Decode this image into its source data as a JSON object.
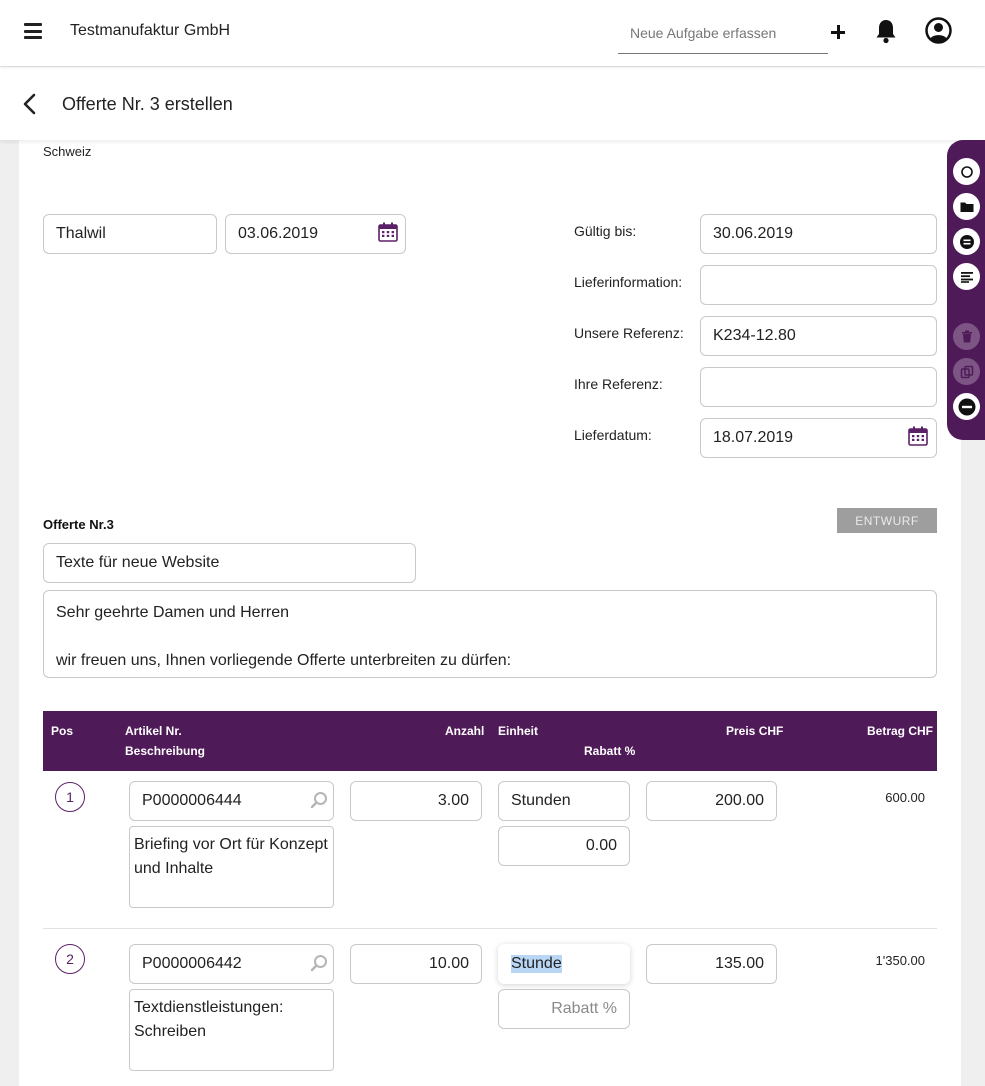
{
  "topbar": {
    "company": "Testmanufaktur GmbH",
    "task_placeholder": "Neue Aufgabe erfassen"
  },
  "subheader": {
    "title": "Offerte Nr. 3 erstellen"
  },
  "address": {
    "country": "Schweiz"
  },
  "place": {
    "city": "Thalwil",
    "date": "03.06.2019"
  },
  "details": {
    "valid_until_label": "Gültig bis:",
    "valid_until": "30.06.2019",
    "delivery_info_label": "Lieferinformation:",
    "delivery_info": "",
    "our_ref_label": "Unsere Referenz:",
    "our_ref": "K234-12.80",
    "your_ref_label": "Ihre Referenz:",
    "your_ref": "",
    "delivery_date_label": "Lieferdatum:",
    "delivery_date": "18.07.2019"
  },
  "offer": {
    "heading": "Offerte Nr.3",
    "status": "ENTWURF",
    "subject": "Texte für neue Website",
    "intro_line1": "Sehr geehrte Damen und Herren",
    "intro_line2": "wir freuen uns, Ihnen vorliegende Offerte unterbreiten zu dürfen:"
  },
  "table": {
    "headers": {
      "pos": "Pos",
      "article": "Artikel Nr.",
      "description": "Beschreibung",
      "quantity": "Anzahl",
      "unit": "Einheit",
      "discount": "Rabatt %",
      "price": "Preis CHF",
      "amount": "Betrag CHF"
    },
    "rows": [
      {
        "pos": "1",
        "article": "P0000006444",
        "description_line1": "Briefing vor Ort für Konzept",
        "description_line2": "und Inhalte",
        "quantity": "3.00",
        "unit": "Stunden",
        "discount": "0.00",
        "discount_placeholder": "",
        "price": "200.00",
        "amount": "600.00"
      },
      {
        "pos": "2",
        "article": "P0000006442",
        "description_line1": "Textdienstleistungen:",
        "description_line2": "Schreiben",
        "quantity": "10.00",
        "unit": "Stunde",
        "discount": "",
        "discount_placeholder": "Rabatt %",
        "price": "135.00",
        "amount": "1'350.00"
      }
    ]
  },
  "colors": {
    "brand_purple": "#4f1a58",
    "badge_gray": "#9e9e9e",
    "calendar_purple": "#5b2167"
  }
}
